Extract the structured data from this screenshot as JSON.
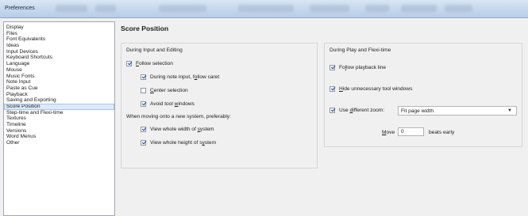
{
  "window": {
    "title": "Preferences"
  },
  "sidebar": {
    "items": [
      "Display",
      "Files",
      "Font Equivalents",
      "Ideas",
      "Input Devices",
      "Keyboard Shortcuts",
      "Language",
      "Mouse",
      "Music Fonts",
      "Note Input",
      "Paste as Cue",
      "Playback",
      "Saving and Exporting",
      "Score Position",
      "Step-time and Flexi-time",
      "Textures",
      "Timeline",
      "Versions",
      "Word Menus",
      "Other"
    ],
    "selected": "Score Position"
  },
  "main": {
    "heading": "Score Position",
    "left_group": {
      "label": "During Input and Editing",
      "follow_selection": {
        "pre": "",
        "u": "F",
        "post": "ollow selection",
        "checked": true
      },
      "during_note_input": {
        "pre": "During note input, f",
        "u": "o",
        "post": "llow caret",
        "checked": true
      },
      "center_selection": {
        "pre": "",
        "u": "C",
        "post": "enter selection",
        "checked": false
      },
      "avoid_tool_windows": {
        "pre": "Avoid tool ",
        "u": "w",
        "post": "indows",
        "checked": true
      },
      "moving_label": "When moving onto a new system, preferably:",
      "view_width": {
        "pre": "View whole width of ",
        "u": "s",
        "post": "ystem",
        "checked": true
      },
      "view_height": {
        "pre": "View whole height of s",
        "u": "y",
        "post": "stem",
        "checked": true
      }
    },
    "right_group": {
      "label": "During Play and Flexi-time",
      "follow_playback": {
        "pre": "Fo",
        "u": "l",
        "post": "low playback line",
        "checked": true
      },
      "hide_tool_windows": {
        "pre": "",
        "u": "H",
        "post": "ide unnecessary tool windows",
        "checked": true
      },
      "different_zoom": {
        "pre": "Use ",
        "u": "d",
        "post": "ifferent zoom:",
        "checked": true
      },
      "zoom_value": "Fit page width",
      "move_pre": "",
      "move_u": "M",
      "move_post": "ove",
      "move_value": "0",
      "beats_early": "beats early"
    }
  }
}
